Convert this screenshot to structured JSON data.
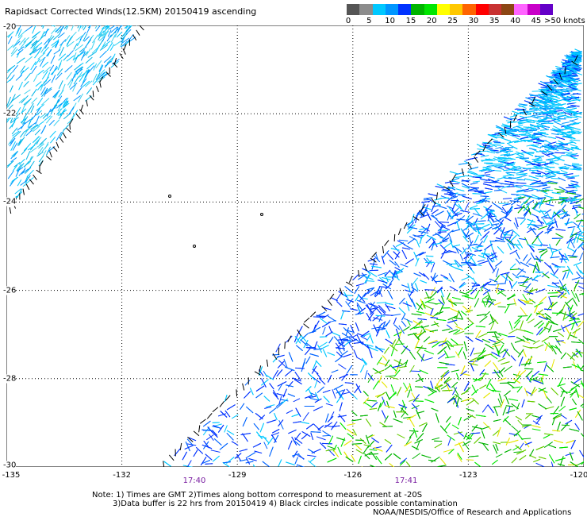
{
  "title": "Rapidsact Corrected Winds(12.5KM) 20150419 ascending",
  "colorbar": {
    "colors": [
      "#555555",
      "#8c8c8c",
      "#00c8ff",
      "#0096ff",
      "#0032ff",
      "#00b400",
      "#00e600",
      "#ffff00",
      "#ffc800",
      "#ff6400",
      "#ff0000",
      "#c83232",
      "#8c4614",
      "#ff64ff",
      "#c800c8",
      "#6400c8"
    ],
    "labels": [
      "0",
      "5",
      "10",
      "15",
      "20",
      "25",
      "30",
      "35",
      "40",
      "45"
    ],
    "unit_label": ">50 knots"
  },
  "axes": {
    "x_ticks": [
      "-135",
      "-132",
      "-129",
      "-126",
      "-123",
      "-120"
    ],
    "y_ticks": [
      "-20",
      "-22",
      "-24",
      "-26",
      "-28",
      "-30"
    ]
  },
  "times": [
    "17:40",
    "17:41"
  ],
  "notes": {
    "line1": "Note: 1) Times are GMT 2)Times along bottom correspond to measurement at -20S",
    "line2": "3)Data buffer is 22 hrs from 20150419 4) Black circles indicate possible contamination",
    "credit": "NOAA/NESDIS/Office of Research and Applications"
  }
}
